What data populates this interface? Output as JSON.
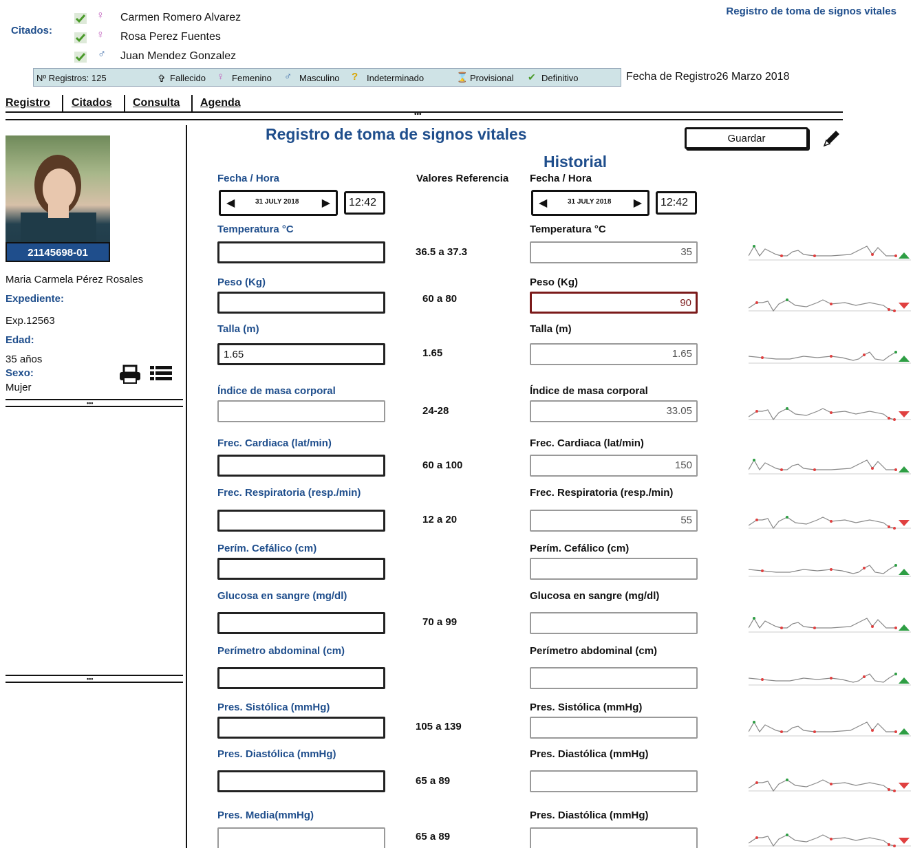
{
  "header": {
    "citados_label": "Citados:",
    "page_link": "Registro de toma de signos vitales",
    "citados": [
      {
        "name": "Carmen Romero Alvarez",
        "sex_icon": "female-icon"
      },
      {
        "name": "Rosa Perez Fuentes",
        "sex_icon": "female-icon"
      },
      {
        "name": "Juan Mendez Gonzalez",
        "sex_icon": "male-icon"
      }
    ],
    "registros": "Nº Registros: 125",
    "legend": {
      "fallecido": "Fallecido",
      "femenino": "Femenino",
      "masculino": "Masculino",
      "indeterminado": "Indeterminado",
      "provisional": "Provisional",
      "definitivo": "Definitivo"
    },
    "fecha_registro": "Fecha de Registro26 Marzo 2018"
  },
  "nav": {
    "registro": "Registro",
    "citados": "Citados",
    "consulta": "Consulta",
    "agenda": "Agenda"
  },
  "patient": {
    "id": "21145698-01",
    "name": "Maria Carmela Pérez Rosales",
    "expediente_label": "Expediente:",
    "expediente": "Exp.12563",
    "edad_label": "Edad:",
    "edad": "35 años",
    "sexo_label": "Sexo:",
    "sexo": "Mujer"
  },
  "form": {
    "title": "Registro de toma de signos vitales",
    "save": "Guardar",
    "historial": "Historial",
    "fecha_hora": "Fecha / Hora",
    "valores_ref": "Valores Referencia",
    "date": "31 JULY 2018",
    "time": "12:42",
    "hist_date": "31 JULY 2018",
    "hist_time": "12:42"
  },
  "rows": [
    {
      "label": "Temperatura  °C",
      "value": "",
      "ref": "36.5 a 37.3",
      "hist_label": "Temperatura  °C",
      "hist": "35",
      "trend": "up"
    },
    {
      "label": "Peso (Kg)",
      "value": "",
      "ref": "60 a 80",
      "hist_label": "Peso (Kg)",
      "hist": "90",
      "trend": "down"
    },
    {
      "label": "Talla (m)",
      "value": "1.65",
      "ref": "1.65",
      "hist_label": "Talla (m)",
      "hist": "1.65",
      "trend": "up"
    },
    {
      "label": "Índice de masa corporal",
      "value": "",
      "ref": "24-28",
      "hist_label": "Índice de masa corporal",
      "hist": "33.05",
      "trend": "down"
    },
    {
      "label": "Frec. Cardiaca (lat/min)",
      "value": "",
      "ref": "60 a 100",
      "hist_label": "Frec. Cardiaca (lat/min)",
      "hist": "150",
      "trend": "up"
    },
    {
      "label": "Frec. Respiratoria (resp./min)",
      "value": "",
      "ref": "12 a 20",
      "hist_label": "Frec. Respiratoria (resp./min)",
      "hist": "55",
      "trend": "down"
    },
    {
      "label": "Perím. Cefálico (cm)",
      "value": "",
      "ref": "",
      "hist_label": "Perím. Cefálico (cm)",
      "hist": "",
      "trend": "up"
    },
    {
      "label": "Glucosa en sangre (mg/dl)",
      "value": "",
      "ref": "70 a 99",
      "hist_label": "Glucosa en sangre (mg/dl)",
      "hist": "",
      "trend": "up"
    },
    {
      "label": "Perímetro abdominal (cm)",
      "value": "",
      "ref": "",
      "hist_label": "Perímetro abdominal (cm)",
      "hist": "",
      "trend": "up"
    },
    {
      "label": "Pres. Sistólica (mmHg)",
      "value": "",
      "ref": "105 a 139",
      "hist_label": "Pres. Sistólica (mmHg)",
      "hist": "",
      "trend": "up"
    },
    {
      "label": "Pres. Diastólica (mmHg)",
      "value": "",
      "ref": "65 a 89",
      "hist_label": "Pres. Diastólica (mmHg)",
      "hist": "",
      "trend": "down"
    },
    {
      "label": "Pres. Media(mmHg)",
      "value": "",
      "ref": "65 a 89",
      "hist_label": "Pres. Diastólica (mmHg)",
      "hist": "",
      "trend": "down"
    }
  ],
  "colors": {
    "accent": "#1f4e8c",
    "legend_bar": "#cfe3e6",
    "alert": "#7b1a1a",
    "trend_up": "#2e9e44",
    "trend_down": "#e04040"
  }
}
